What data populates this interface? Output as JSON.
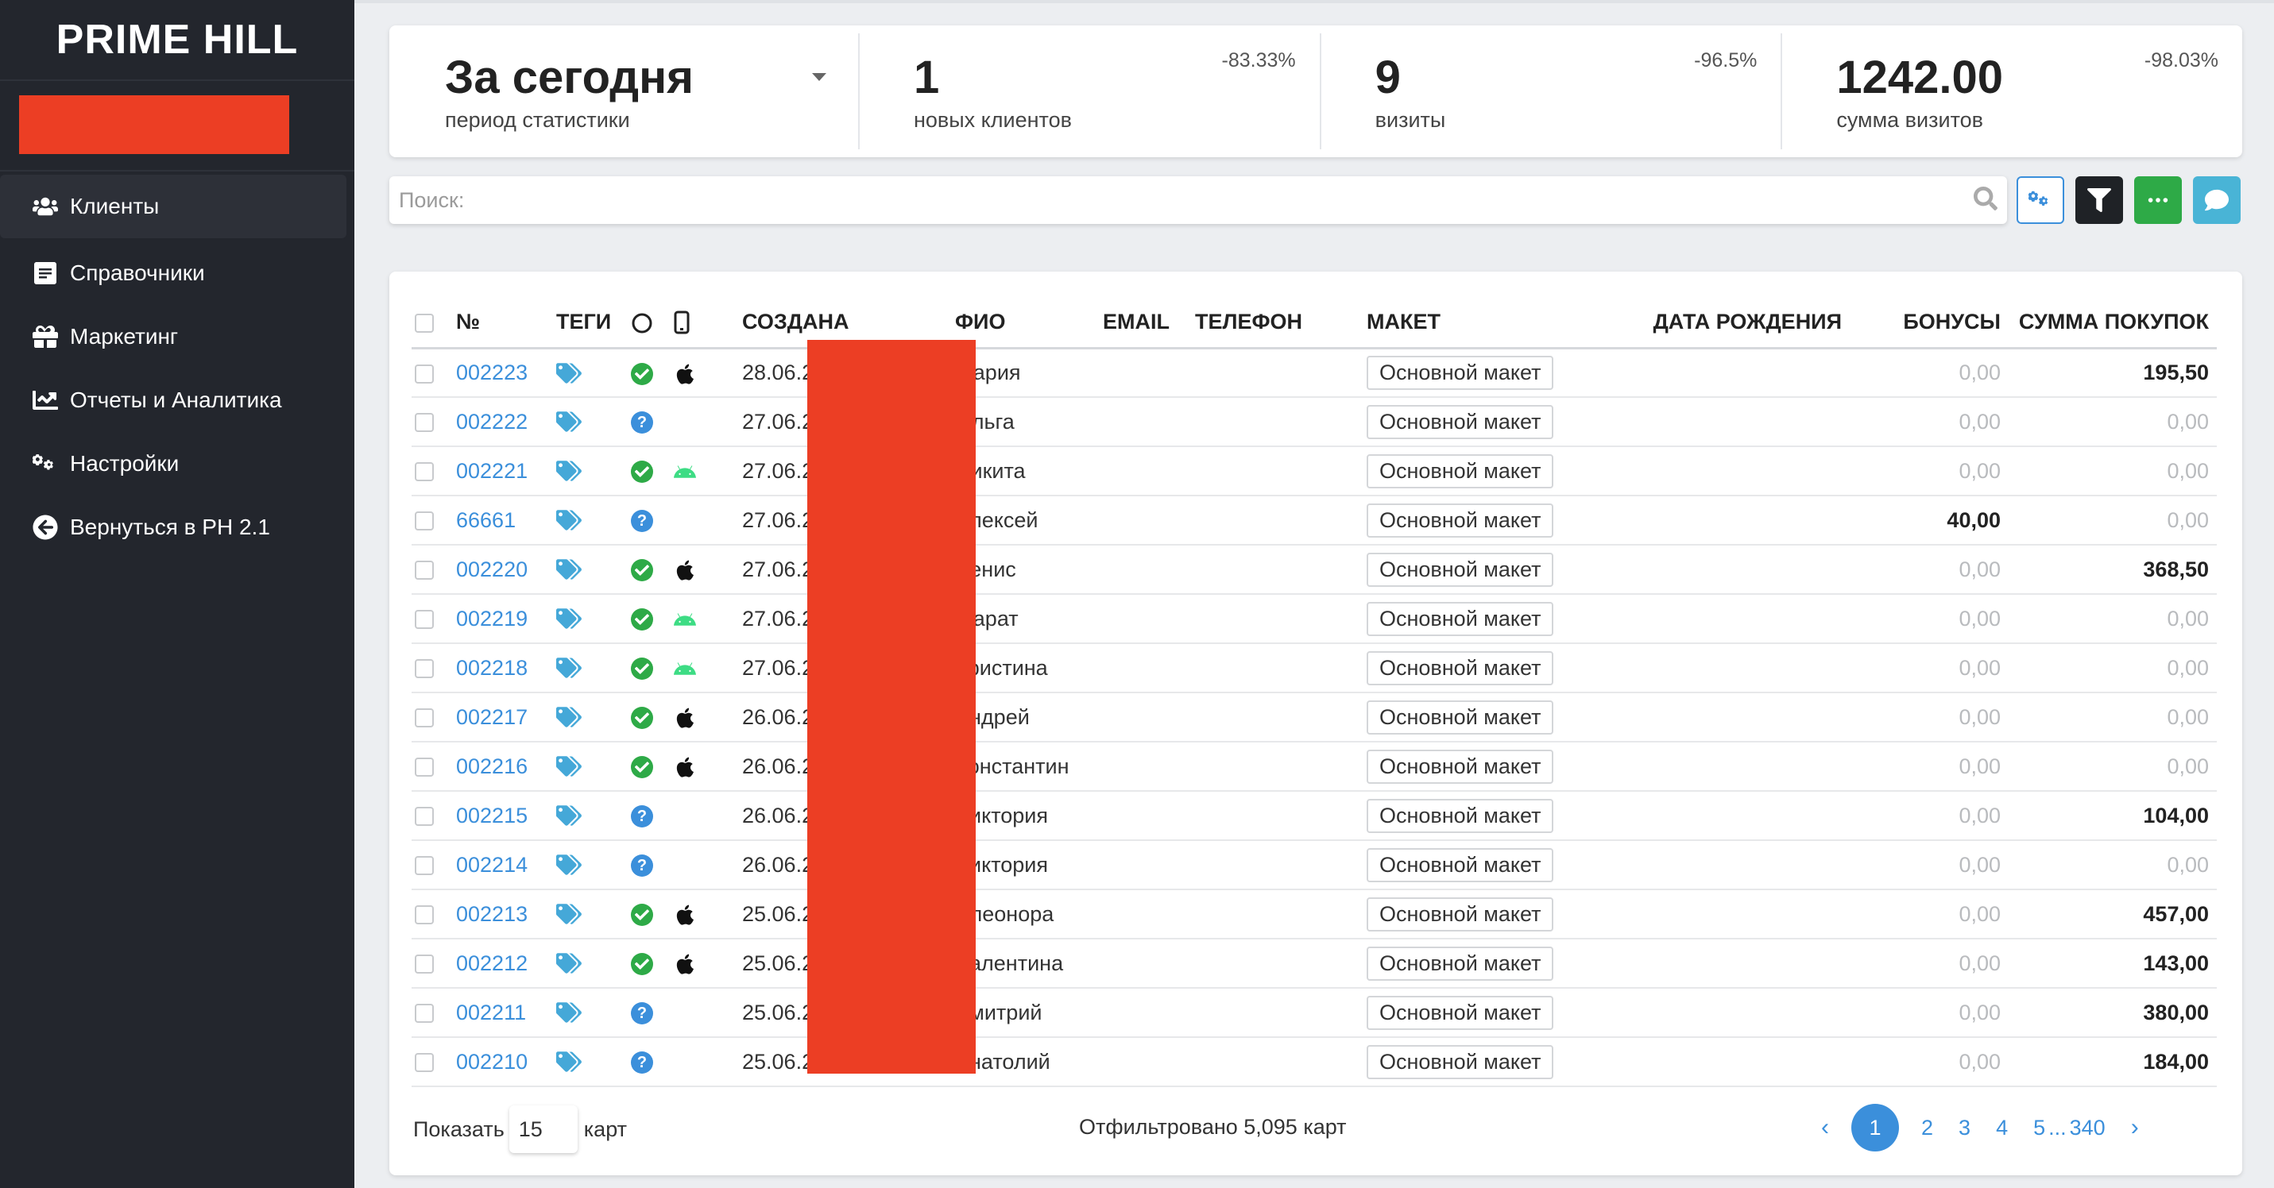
{
  "sidebar": {
    "logo": "PRIME HILL",
    "items": [
      {
        "label": "Клиенты",
        "icon": "users-icon",
        "active": true
      },
      {
        "label": "Справочники",
        "icon": "book-icon"
      },
      {
        "label": "Маркетинг",
        "icon": "gift-icon"
      },
      {
        "label": "Отчеты и Аналитика",
        "icon": "chart-line-icon"
      },
      {
        "label": "Настройки",
        "icon": "gears-icon"
      },
      {
        "label": "Вернуться в PH 2.1",
        "icon": "arrow-circle-left-icon"
      }
    ]
  },
  "stats": {
    "period": {
      "value": "За сегодня",
      "label": "период статистики"
    },
    "new_clients": {
      "value": "1",
      "label": "новых клиентов",
      "delta": "-83.33%"
    },
    "visits": {
      "value": "9",
      "label": "визиты",
      "delta": "-96.5%"
    },
    "visits_sum": {
      "value": "1242.00",
      "label": "сумма визитов",
      "delta": "-98.03%"
    }
  },
  "search": {
    "placeholder": "Поиск:"
  },
  "colors": {
    "accent": "#3b8fdb",
    "sidebar": "#23262d",
    "redact": "#ec3e24",
    "success": "#2eaa47",
    "info": "#49b4d6"
  },
  "table": {
    "headers": {
      "num": "№",
      "tags": "ТЕГИ",
      "created": "СОЗДАНА",
      "name": "ФИО",
      "email": "EMAIL",
      "phone": "ТЕЛЕФОН",
      "maket": "МАКЕТ",
      "birthday": "ДАТА РОЖДЕНИЯ",
      "bonus": "БОНУСЫ",
      "sum": "СУММА ПОКУПОК"
    },
    "rows": [
      {
        "num": "002223",
        "status": "ok",
        "os": "apple",
        "created": "28.06.2023 08:31",
        "name": "Мария",
        "maket": "Основной макет",
        "bonus": "0,00",
        "sum": "195,50"
      },
      {
        "num": "002222",
        "status": "unknown",
        "os": "",
        "created": "27.06.2023 17:58",
        "name": "Ольга",
        "maket": "Основной макет",
        "bonus": "0,00",
        "sum": "0,00"
      },
      {
        "num": "002221",
        "status": "ok",
        "os": "android",
        "created": "27.06.2023 17:42",
        "name": "Никита",
        "maket": "Основной макет",
        "bonus": "0,00",
        "sum": "0,00"
      },
      {
        "num": "66661",
        "status": "unknown",
        "os": "",
        "created": "27.06.2023 17:20",
        "name": "Алексей",
        "maket": "Основной макет",
        "bonus": "40,00",
        "sum": "0,00"
      },
      {
        "num": "002220",
        "status": "ok",
        "os": "apple",
        "created": "27.06.2023 15:04",
        "name": "Денис",
        "maket": "Основной макет",
        "bonus": "0,00",
        "sum": "368,50"
      },
      {
        "num": "002219",
        "status": "ok",
        "os": "android",
        "created": "27.06.2023 14:03",
        "name": "Марат",
        "maket": "Основной макет",
        "bonus": "0,00",
        "sum": "0,00"
      },
      {
        "num": "002218",
        "status": "ok",
        "os": "android",
        "created": "27.06.2023 09:53",
        "name": "Кристина",
        "maket": "Основной макет",
        "bonus": "0,00",
        "sum": "0,00"
      },
      {
        "num": "002217",
        "status": "ok",
        "os": "apple",
        "created": "26.06.2023 14:40",
        "name": "Андрей",
        "maket": "Основной макет",
        "bonus": "0,00",
        "sum": "0,00"
      },
      {
        "num": "002216",
        "status": "ok",
        "os": "apple",
        "created": "26.06.2023 13:53",
        "name": "Константин",
        "maket": "Основной макет",
        "bonus": "0,00",
        "sum": "0,00"
      },
      {
        "num": "002215",
        "status": "unknown",
        "os": "",
        "created": "26.06.2023 12:28",
        "name": "Виктория",
        "maket": "Основной макет",
        "bonus": "0,00",
        "sum": "104,00"
      },
      {
        "num": "002214",
        "status": "unknown",
        "os": "",
        "created": "26.06.2023 12:00",
        "name": "Виктория",
        "maket": "Основной макет",
        "bonus": "0,00",
        "sum": "0,00"
      },
      {
        "num": "002213",
        "status": "ok",
        "os": "apple",
        "created": "25.06.2023 17:12",
        "name": "Элеонора",
        "maket": "Основной макет",
        "bonus": "0,00",
        "sum": "457,00"
      },
      {
        "num": "002212",
        "status": "ok",
        "os": "apple",
        "created": "25.06.2023 14:56",
        "name": "Валентина",
        "maket": "Основной макет",
        "bonus": "0,00",
        "sum": "143,00"
      },
      {
        "num": "002211",
        "status": "unknown",
        "os": "",
        "created": "25.06.2023 12:25",
        "name": "Дмитрий",
        "maket": "Основной макет",
        "bonus": "0,00",
        "sum": "380,00"
      },
      {
        "num": "002210",
        "status": "unknown",
        "os": "",
        "created": "25.06.2023 12:25",
        "name": "Анатолий",
        "maket": "Основной макет",
        "bonus": "0,00",
        "sum": "184,00"
      }
    ]
  },
  "footer": {
    "show_label": "Показать",
    "per_page": "15",
    "per_page_unit": "карт",
    "filtered": "Отфильтровано 5,095 карт",
    "pages": [
      "1",
      "2",
      "3",
      "4",
      "5"
    ],
    "ellipsis": "...",
    "last_page": "340",
    "prev": "‹",
    "next": "›"
  }
}
